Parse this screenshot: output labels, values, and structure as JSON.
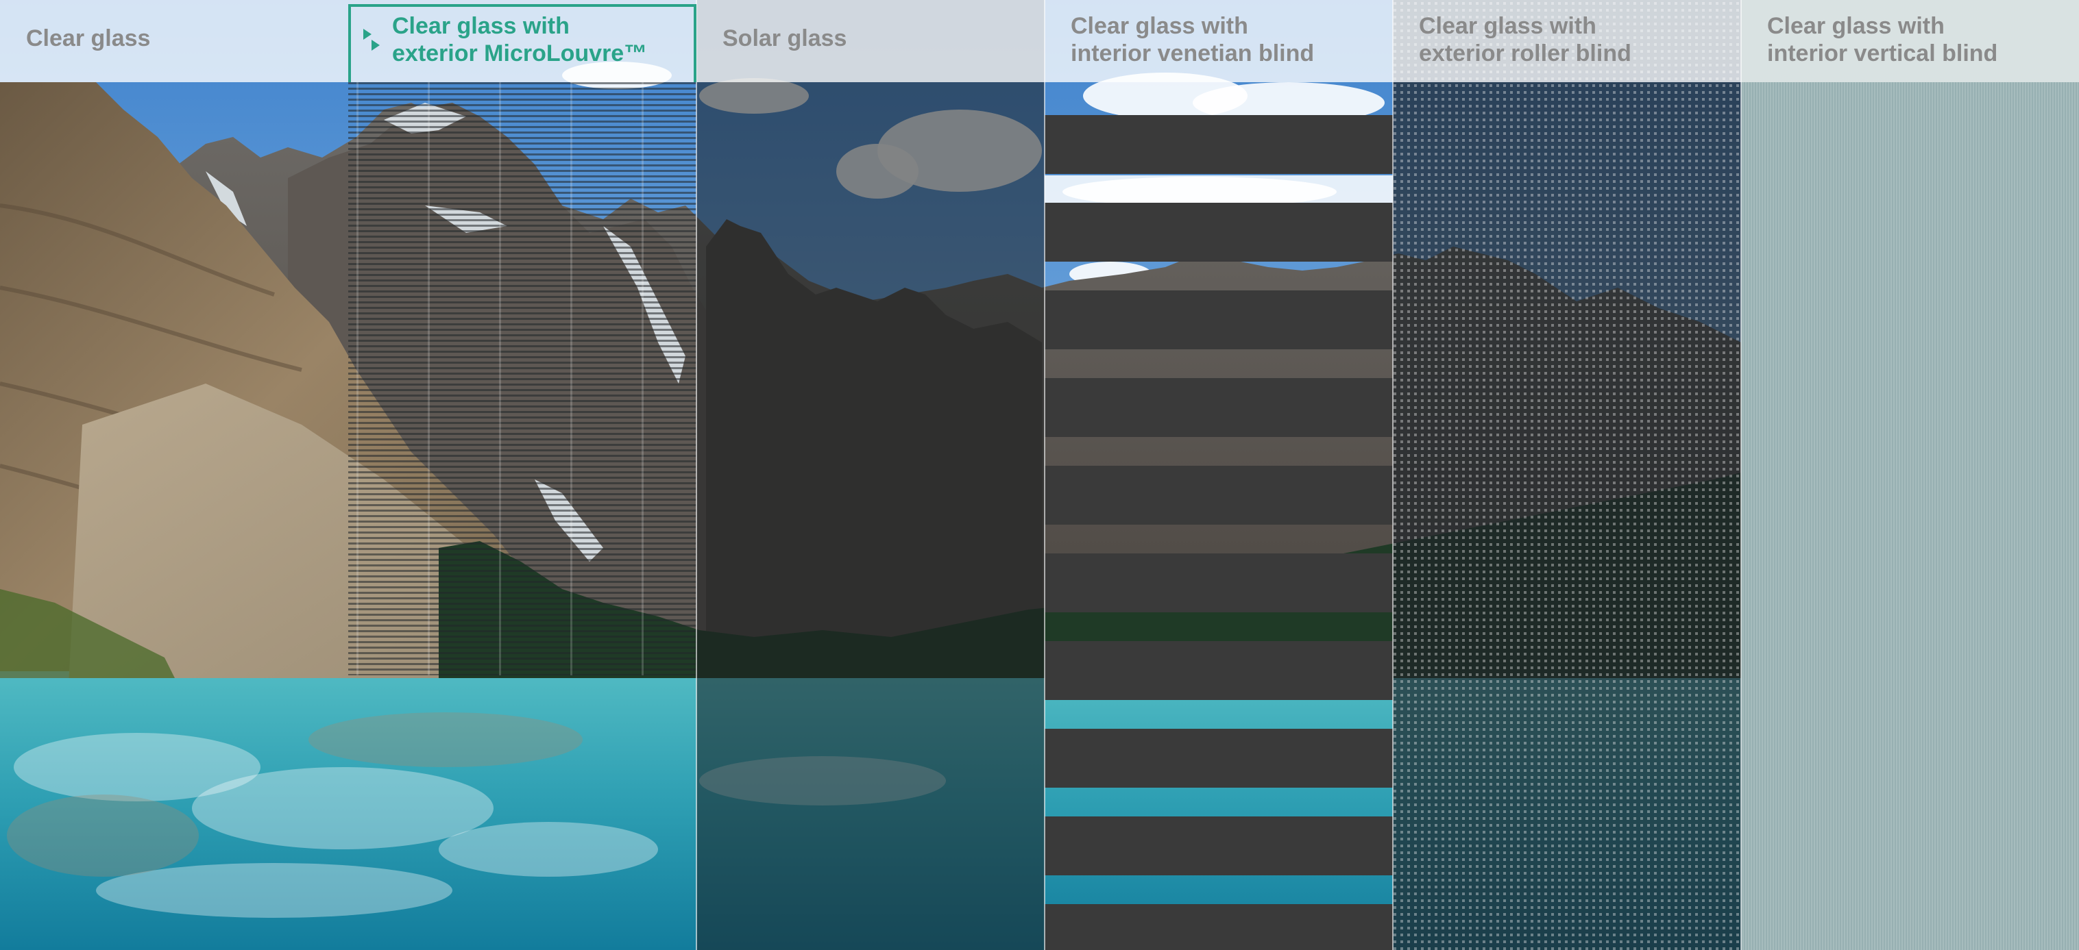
{
  "panels": [
    {
      "id": "clear",
      "label": "Clear glass"
    },
    {
      "id": "microlouvre",
      "label": "Clear glass with\nexterior MicroLouvre™"
    },
    {
      "id": "solar",
      "label": "Solar glass"
    },
    {
      "id": "venetian",
      "label": "Clear glass with\ninterior venetian blind"
    },
    {
      "id": "roller",
      "label": "Clear glass with\nexterior roller blind"
    },
    {
      "id": "vertical",
      "label": "Clear glass with\ninterior vertical blind"
    }
  ],
  "colors": {
    "highlight": "#2aa389",
    "label_gray": "#8a8a8a",
    "sky": "#4f8ed0",
    "lake": "#3aa7b4",
    "slat": "#3a3a3a",
    "vertical_blind": "#9fb8b9"
  },
  "icons": [
    "microlouvre-logo-icon"
  ]
}
